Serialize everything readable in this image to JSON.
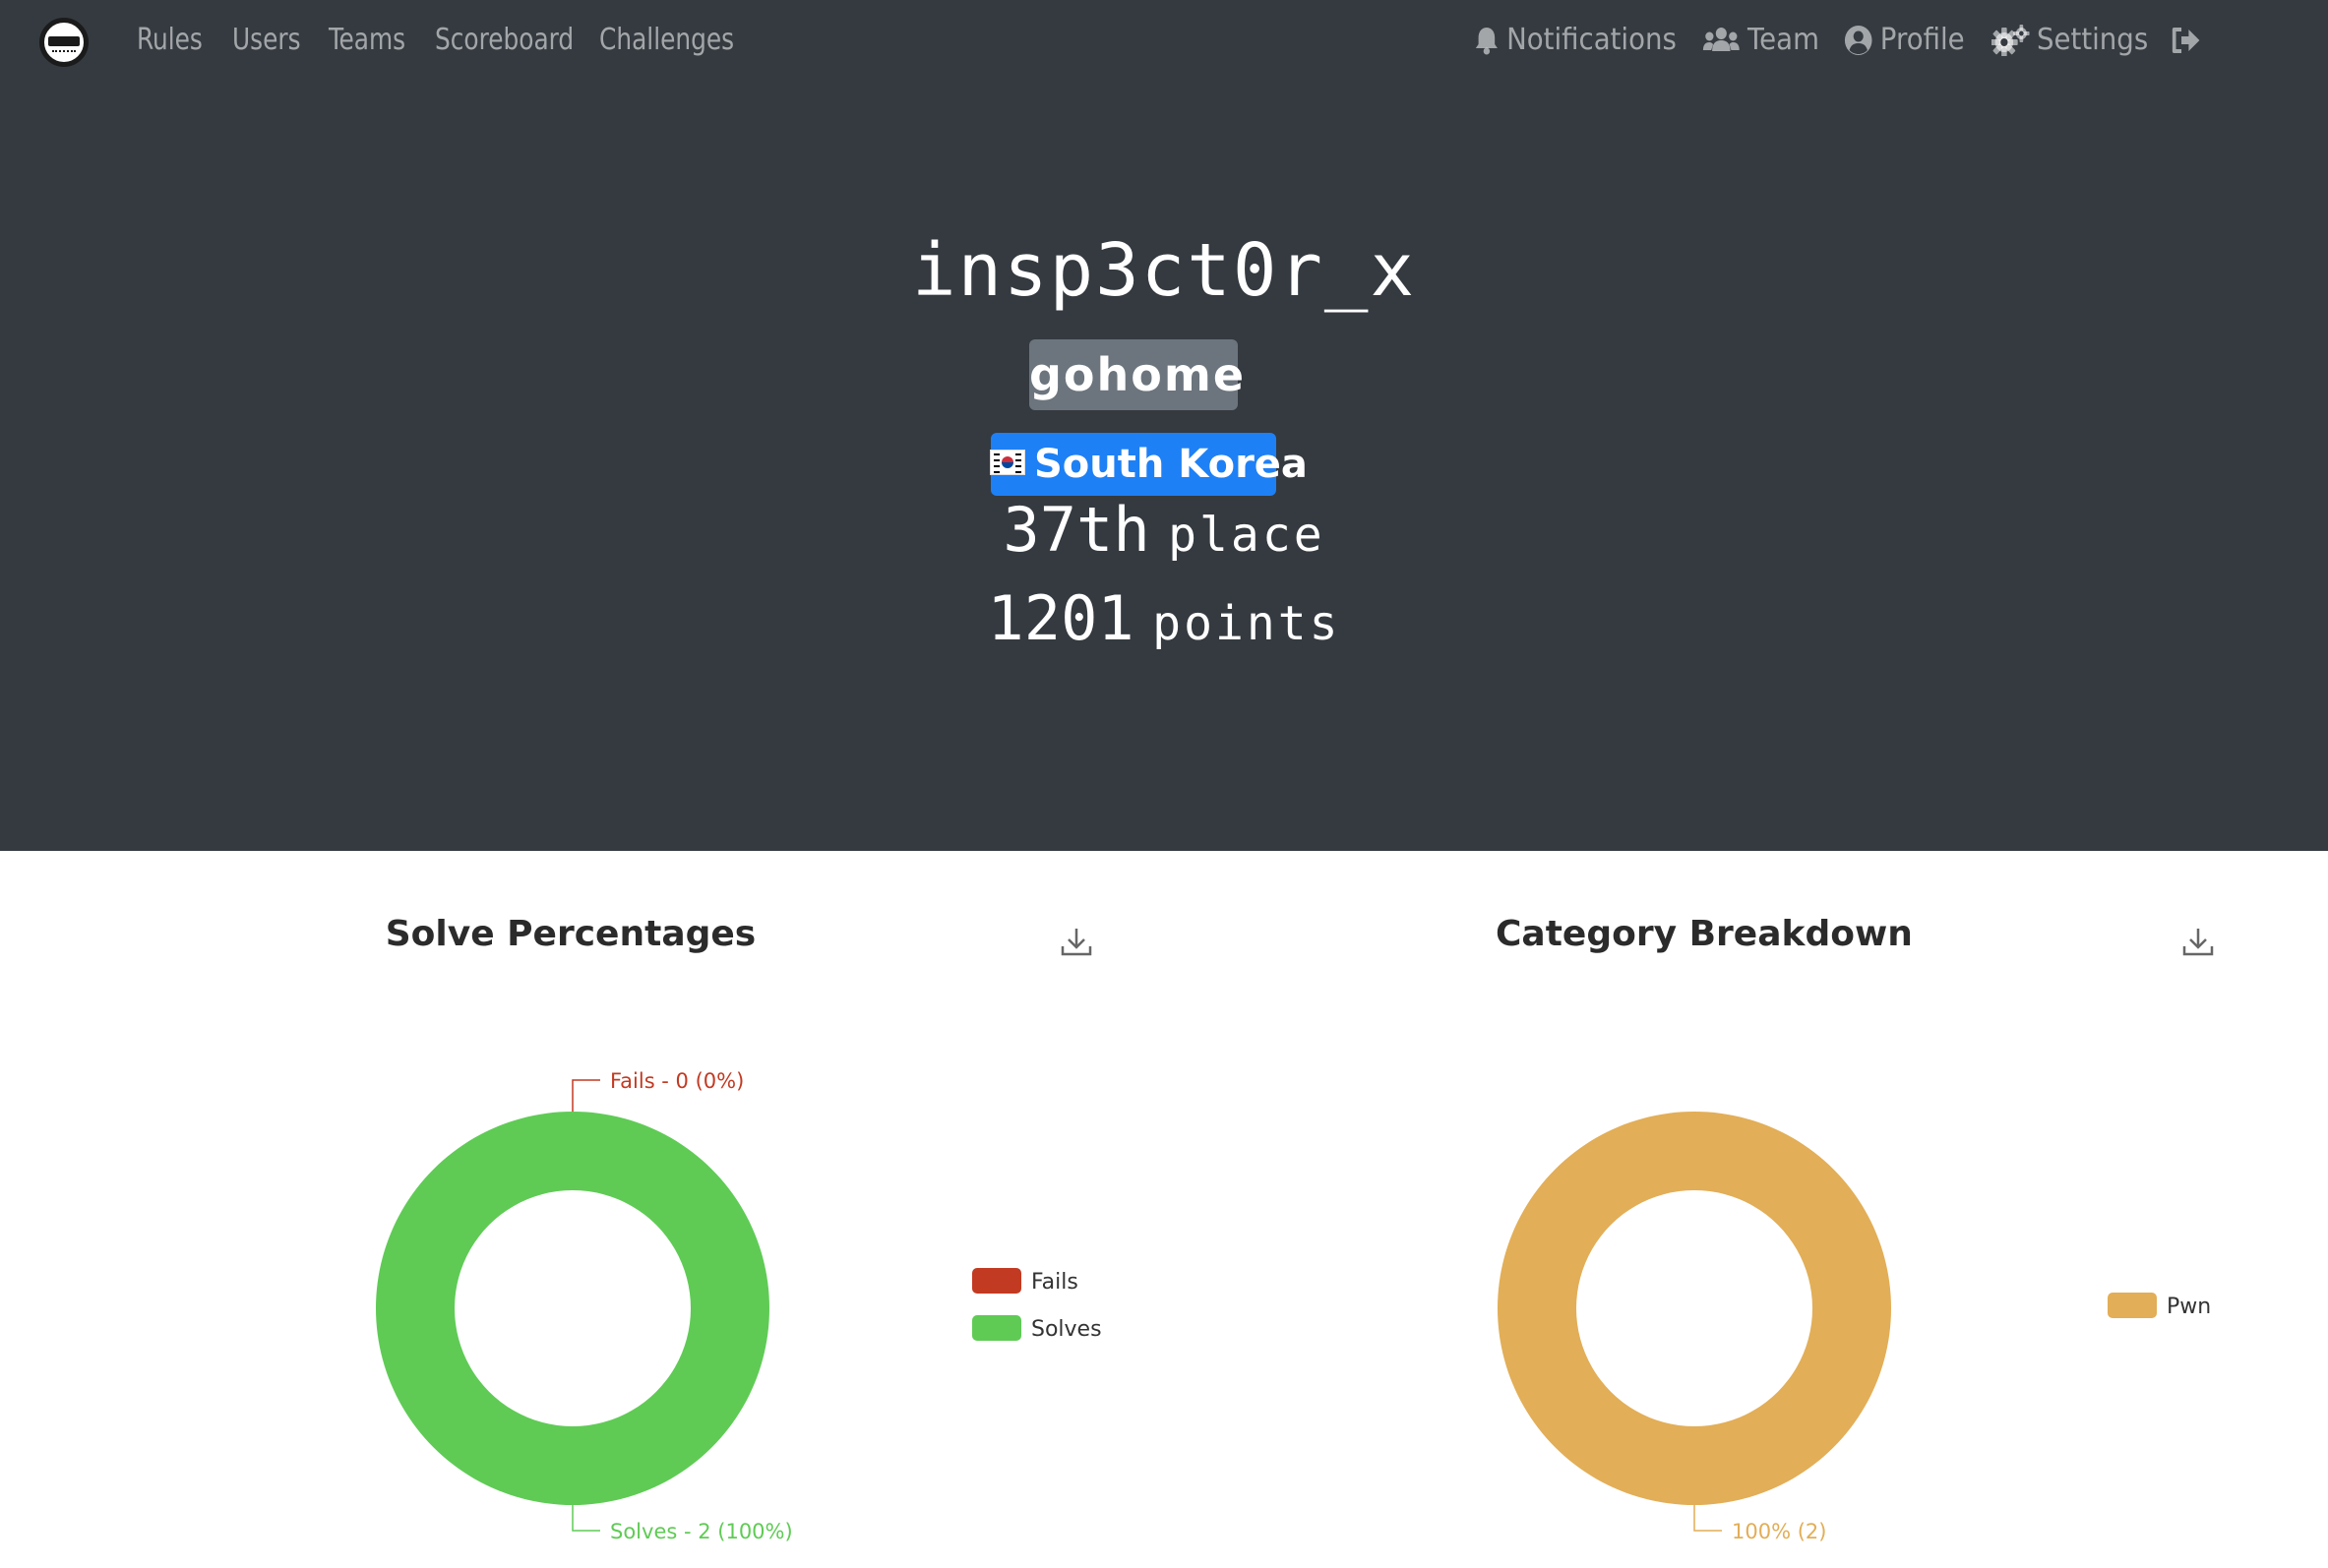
{
  "nav": {
    "left": [
      "Rules",
      "Users",
      "Teams",
      "Scoreboard",
      "Challenges"
    ],
    "notifications": "Notifications",
    "team": "Team",
    "profile": "Profile",
    "settings": "Settings"
  },
  "profile": {
    "username": "insp3ct0r_x",
    "team": "gohome",
    "country": "South Korea",
    "place_num": "37th",
    "place_word": "place",
    "points_num": "1201",
    "points_word": "points"
  },
  "colors": {
    "navbar": "#343a40",
    "fails": "#c23a22",
    "solves": "#5fcb55",
    "pwn": "#e2ae57",
    "country_badge": "#1e80f5",
    "team_badge": "#6c757d"
  },
  "chart_data": [
    {
      "type": "pie",
      "title": "Solve Percentages",
      "categories": [
        "Fails",
        "Solves"
      ],
      "values": [
        0,
        2
      ],
      "labels": [
        "Fails - 0 (0%)",
        "Solves - 2 (100%)"
      ],
      "legend": [
        "Fails",
        "Solves"
      ],
      "legend_position": "right",
      "donut": true
    },
    {
      "type": "pie",
      "title": "Category Breakdown",
      "categories": [
        "Pwn"
      ],
      "values": [
        2
      ],
      "labels": [
        "100% (2)"
      ],
      "legend": [
        "Pwn"
      ],
      "legend_position": "right",
      "donut": true
    }
  ]
}
